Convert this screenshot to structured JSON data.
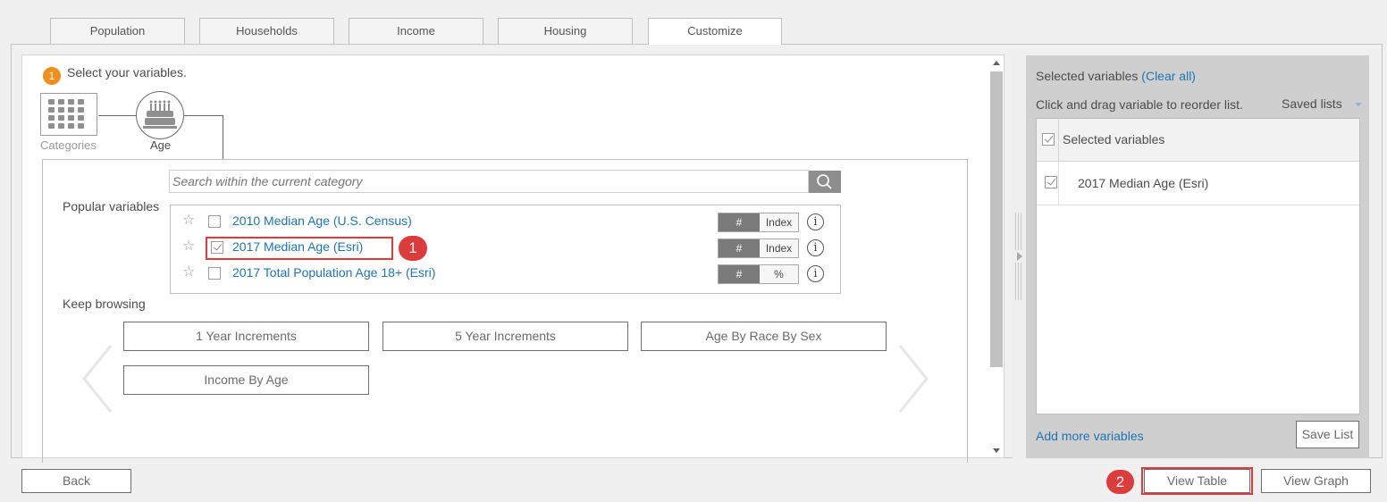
{
  "tabs": [
    {
      "label": "Population"
    },
    {
      "label": "Households"
    },
    {
      "label": "Income"
    },
    {
      "label": "Housing"
    },
    {
      "label": "Customize"
    }
  ],
  "step": {
    "number": "1",
    "label": "Select your variables."
  },
  "breadcrumb": {
    "categories_label": "Categories",
    "age_label": "Age"
  },
  "search": {
    "placeholder": "Search within the current category"
  },
  "popular": {
    "heading": "Popular variables",
    "items": [
      {
        "label": "2010 Median Age (U.S. Census)",
        "checked": false,
        "toggle_left": "#",
        "toggle_right": "Index"
      },
      {
        "label": "2017 Median Age (Esri)",
        "checked": true,
        "toggle_left": "#",
        "toggle_right": "Index"
      },
      {
        "label": "2017 Total Population Age 18+ (Esri)",
        "checked": false,
        "toggle_left": "#",
        "toggle_right": "%"
      }
    ]
  },
  "browse": {
    "heading": "Keep browsing",
    "buttons": [
      "1 Year Increments",
      "5 Year Increments",
      "Age By Race By Sex",
      "Income By Age"
    ]
  },
  "callouts": {
    "first": "1",
    "second": "2"
  },
  "selected": {
    "title": "Selected variables",
    "clear_all": "(Clear all)",
    "instructions": "Click and drag variable to reorder list.",
    "saved_lists": "Saved lists",
    "header": "Selected variables",
    "items": [
      "2017 Median Age (Esri)"
    ],
    "add_more": "Add more variables",
    "save_list": "Save List"
  },
  "footer": {
    "back": "Back",
    "view_table": "View Table",
    "view_graph": "View Graph"
  },
  "colors": {
    "accent": "#f08f1c",
    "link": "#1f74b3",
    "callout": "#dc3c3c"
  }
}
